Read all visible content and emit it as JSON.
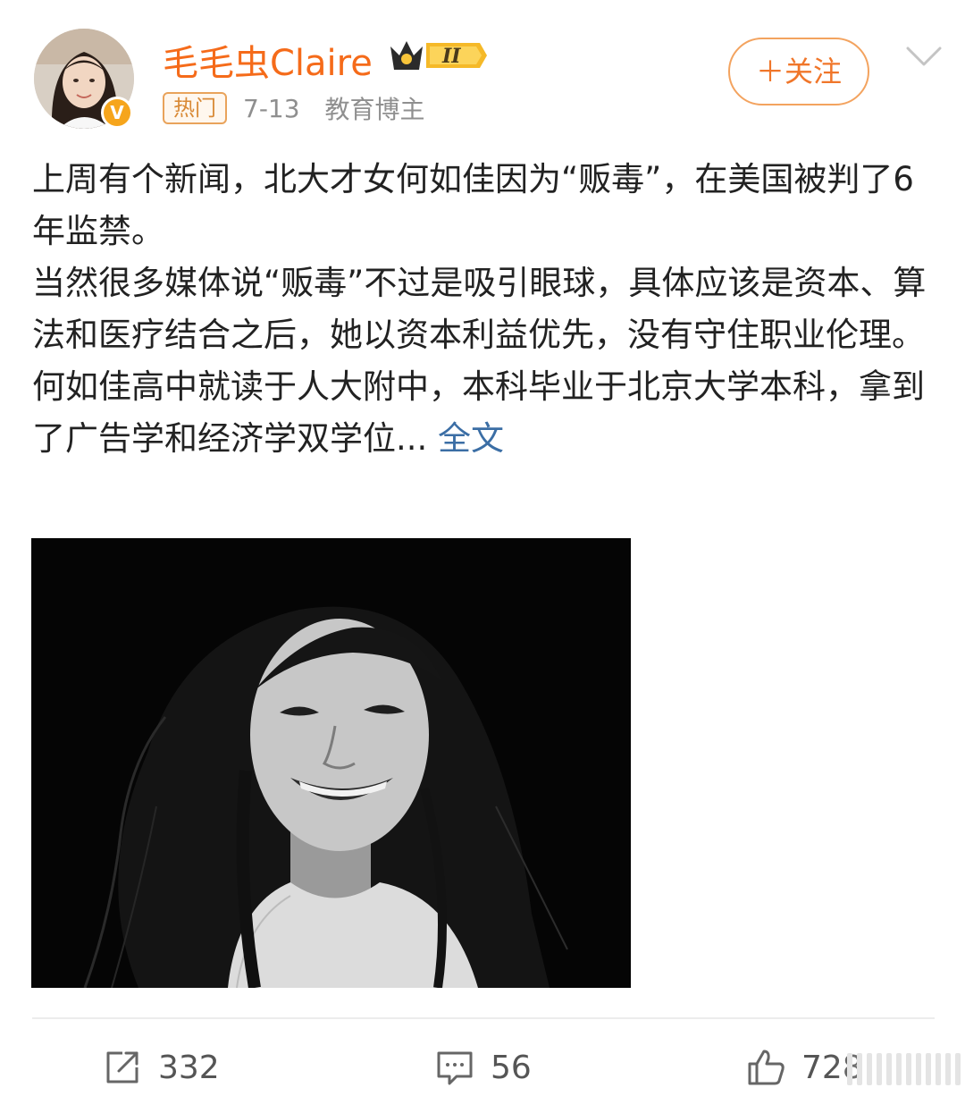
{
  "header": {
    "username": "毛毛虫Claire",
    "vip_level": "II",
    "verified_mark": "V",
    "hot_tag": "热门",
    "date": "7-13",
    "role": "教育博主",
    "follow_label": "＋关注"
  },
  "post": {
    "paragraphs": [
      "上周有个新闻，北大才女何如佳因为“贩毒”，在美国被判了6年监禁。",
      "当然很多媒体说“贩毒”不过是吸引眼球，具体应该是资本、算法和医疗结合之后，她以资本利益优先，没有守住职业伦理。",
      "何如佳高中就读于人大附中，本科毕业于北京大学本科，拿到了广告学和经济学双学位..."
    ],
    "more_label": " 全文"
  },
  "actions": {
    "repost_count": "332",
    "comment_count": "56",
    "like_count": "728"
  },
  "icons": {
    "repost": "repost-icon",
    "comment": "comment-icon",
    "like": "thumbs-up-icon",
    "more": "chevron-down-icon"
  },
  "colors": {
    "username": "#f56b1a",
    "follow": "#f0762a",
    "link": "#3b6ea5",
    "verified": "#f6a51c"
  }
}
